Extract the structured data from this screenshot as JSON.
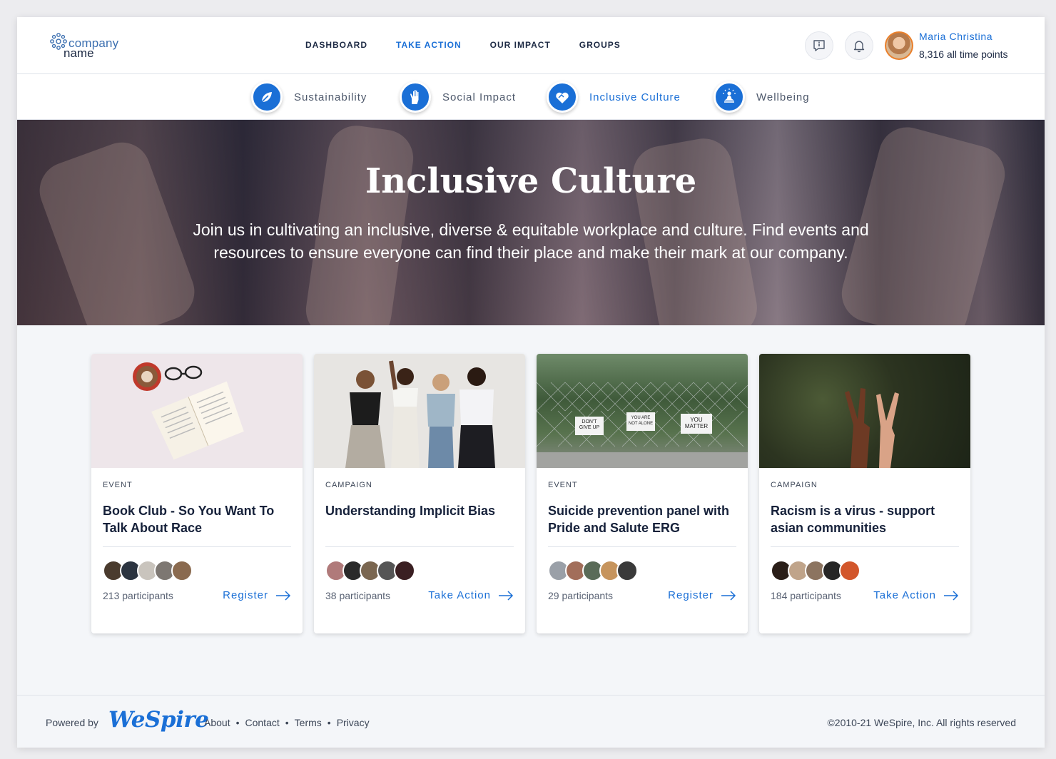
{
  "logo": {
    "line1": "company",
    "line2": "name"
  },
  "nav": {
    "items": [
      {
        "label": "DASHBOARD"
      },
      {
        "label": "TAKE ACTION",
        "active": true
      },
      {
        "label": "OUR IMPACT"
      },
      {
        "label": "GROUPS"
      }
    ]
  },
  "header_icons": [
    "info-icon",
    "bell-icon"
  ],
  "user": {
    "name": "Maria Christina",
    "points": "8,316 all time points"
  },
  "categories": [
    {
      "label": "Sustainability",
      "icon": "leaf-icon"
    },
    {
      "label": "Social Impact",
      "icon": "raised-hand-icon"
    },
    {
      "label": "Inclusive Culture",
      "icon": "heart-hands-icon",
      "active": true
    },
    {
      "label": "Wellbeing",
      "icon": "meditation-icon"
    }
  ],
  "hero": {
    "title": "Inclusive Culture",
    "subtitle": "Join us in cultivating an inclusive, diverse & equitable workplace and culture. Find events and resources to ensure everyone can find their place and make their mark at our company."
  },
  "cards": [
    {
      "type": "EVENT",
      "title": "Book Club - So You Want To Talk About Race",
      "participants": "213 participants",
      "action": "Register",
      "image": "book-coffee-glasses"
    },
    {
      "type": "CAMPAIGN",
      "title": "Understanding Implicit Bias",
      "participants": "38 participants",
      "action": "Take Action",
      "image": "four-women-laughing"
    },
    {
      "type": "EVENT",
      "title": "Suicide prevention panel with Pride and Salute ERG",
      "participants": "29 participants",
      "action": "Register",
      "image": "fence-signs",
      "image_signs": [
        "DON'T GIVE UP",
        "YOU ARE NOT ALONE",
        "YOU MATTER"
      ]
    },
    {
      "type": "CAMPAIGN",
      "title": "Racism is a virus - support asian communities",
      "participants": "184 participants",
      "action": "Take Action",
      "image": "peace-sign-hands"
    }
  ],
  "footer": {
    "powered_by": "Powered by",
    "brand": "WeSpire",
    "links": [
      "About",
      "Contact",
      "Terms",
      "Privacy"
    ],
    "copyright": "©2010-21 WeSpire, Inc. All rights reserved"
  },
  "colors": {
    "accent": "#1a6fd6",
    "text": "#1d2a44",
    "background": "#f4f6f9"
  }
}
